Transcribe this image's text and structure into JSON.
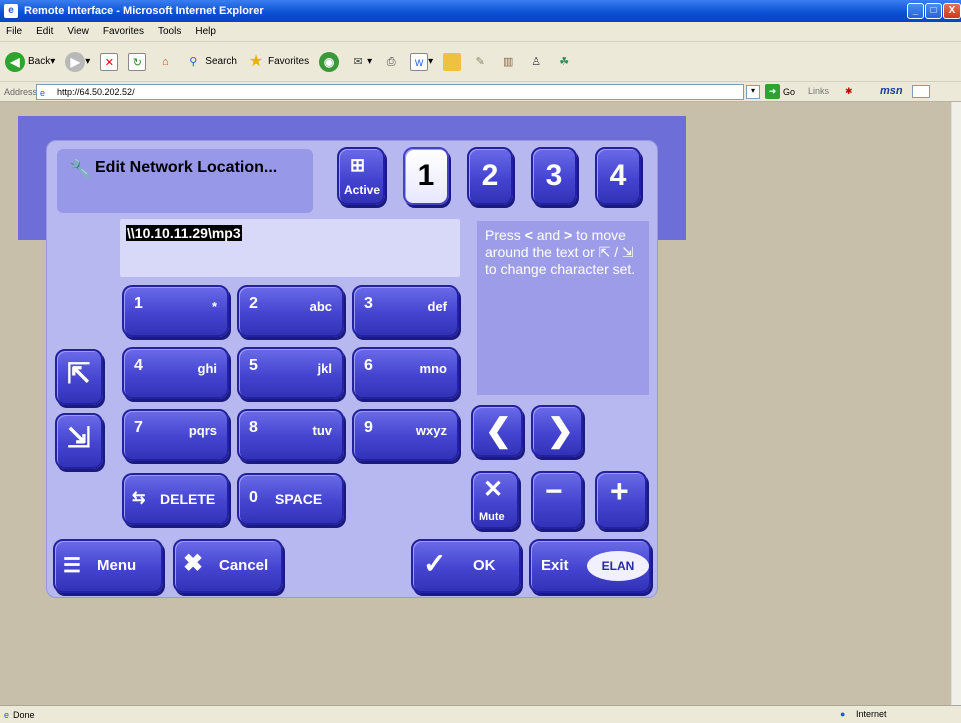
{
  "window": {
    "title": "Remote Interface - Microsoft Internet Explorer",
    "min": "_",
    "max": "□",
    "close": "X"
  },
  "menu": [
    "File",
    "Edit",
    "View",
    "Favorites",
    "Tools",
    "Help"
  ],
  "toolbar": {
    "back": "Back",
    "search": "Search",
    "favorites": "Favorites"
  },
  "address": {
    "label": "Address",
    "url": "http://64.50.202.52/",
    "go": "Go",
    "links": "Links",
    "msn": "msn"
  },
  "status": {
    "left": "Done",
    "zone": "Internet"
  },
  "elan": {
    "header": "Edit Network Location...",
    "active_label": "Active",
    "tabs": [
      "1",
      "2",
      "3",
      "4"
    ],
    "text_value": "\\\\10.10.11.29\\mp3",
    "help": "Press < and > to move around the text or / to change character set.",
    "keys": [
      {
        "n": "1",
        "l": "*"
      },
      {
        "n": "2",
        "l": "abc"
      },
      {
        "n": "3",
        "l": "def"
      },
      {
        "n": "4",
        "l": "ghi"
      },
      {
        "n": "5",
        "l": "jkl"
      },
      {
        "n": "6",
        "l": "mno"
      },
      {
        "n": "7",
        "l": "pqrs"
      },
      {
        "n": "8",
        "l": "tuv"
      },
      {
        "n": "9",
        "l": "wxyz"
      }
    ],
    "delete": "DELETE",
    "zero_n": "0",
    "zero_l": "SPACE",
    "mute": "Mute",
    "menu": "Menu",
    "cancel": "Cancel",
    "ok": "OK",
    "exit": "Exit",
    "brand": "ELAN"
  },
  "colors": {
    "accent": "#4444d0",
    "panel": "#b8b8f0",
    "strip": "#6e6ed8",
    "desktop": "#c8bfab"
  }
}
